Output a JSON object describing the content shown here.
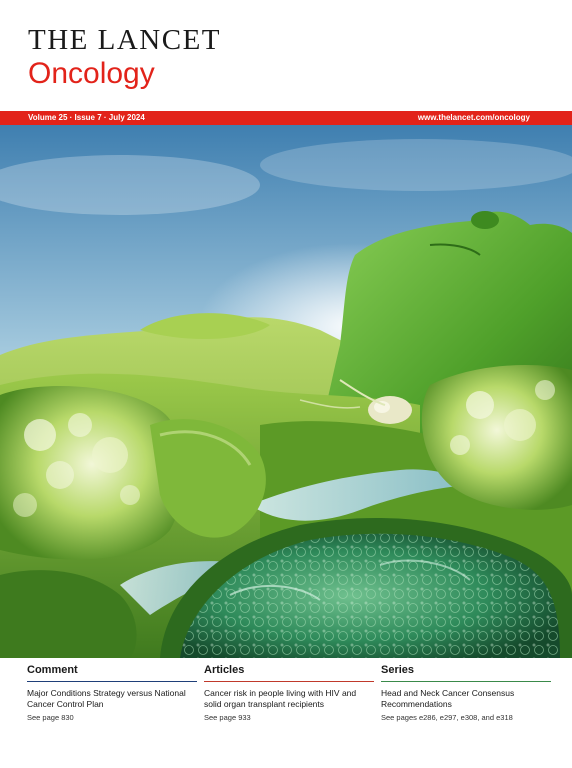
{
  "masthead": {
    "title": "THE LANCET",
    "subtitle": "Oncology"
  },
  "issue_bar": {
    "info": "Volume 25 · Issue 7 · July 2024",
    "url": "www.thelancet.com/oncology"
  },
  "colors": {
    "brand_red": "#e2231a",
    "comment_rule": "#1f3f79",
    "articles_rule": "#c0392b",
    "series_rule": "#3a8a4a",
    "art_green": "#6fb52e"
  },
  "cover_art": {
    "icon": "landscape-illustration"
  },
  "sections": [
    {
      "heading": "Comment",
      "text": "Major Conditions Strategy versus National Cancer Control Plan",
      "pages": "See page 830"
    },
    {
      "heading": "Articles",
      "text": "Cancer risk in people living with HIV and solid organ transplant recipients",
      "pages": "See page 933"
    },
    {
      "heading": "Series",
      "text": "Head and Neck Cancer Consensus Recommendations",
      "pages": "See pages e286, e297, e308, and e318"
    }
  ]
}
